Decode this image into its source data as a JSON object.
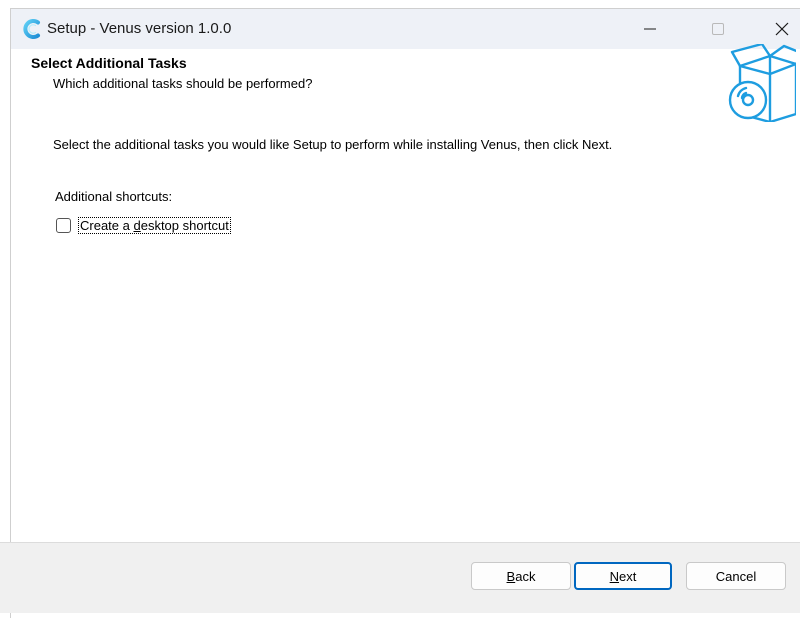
{
  "window": {
    "title": "Setup - Venus version 1.0.0",
    "icons": {
      "app": "venus-c-logo-icon",
      "minimize": "minimize-icon",
      "maximize": "maximize-icon",
      "close": "close-icon"
    }
  },
  "header": {
    "title": "Select Additional Tasks",
    "subtitle": "Which additional tasks should be performed?",
    "icon": "software-box-disc-icon"
  },
  "body": {
    "instructions": "Select the additional tasks you would like Setup to perform while installing Venus, then click Next.",
    "group_label": "Additional shortcuts:",
    "tasks": [
      {
        "label": "Create a desktop shortcut",
        "accel": "d",
        "checked": false
      }
    ]
  },
  "footer": {
    "back": {
      "label": "Back",
      "accel": "B"
    },
    "next": {
      "label": "Next",
      "accel": "N"
    },
    "cancel": {
      "label": "Cancel"
    }
  },
  "colors": {
    "titlebar_bg": "#eef1f7",
    "footer_bg": "#f0f0f0",
    "accent": "#0067c0",
    "icon_blue": "#1e9de0"
  }
}
